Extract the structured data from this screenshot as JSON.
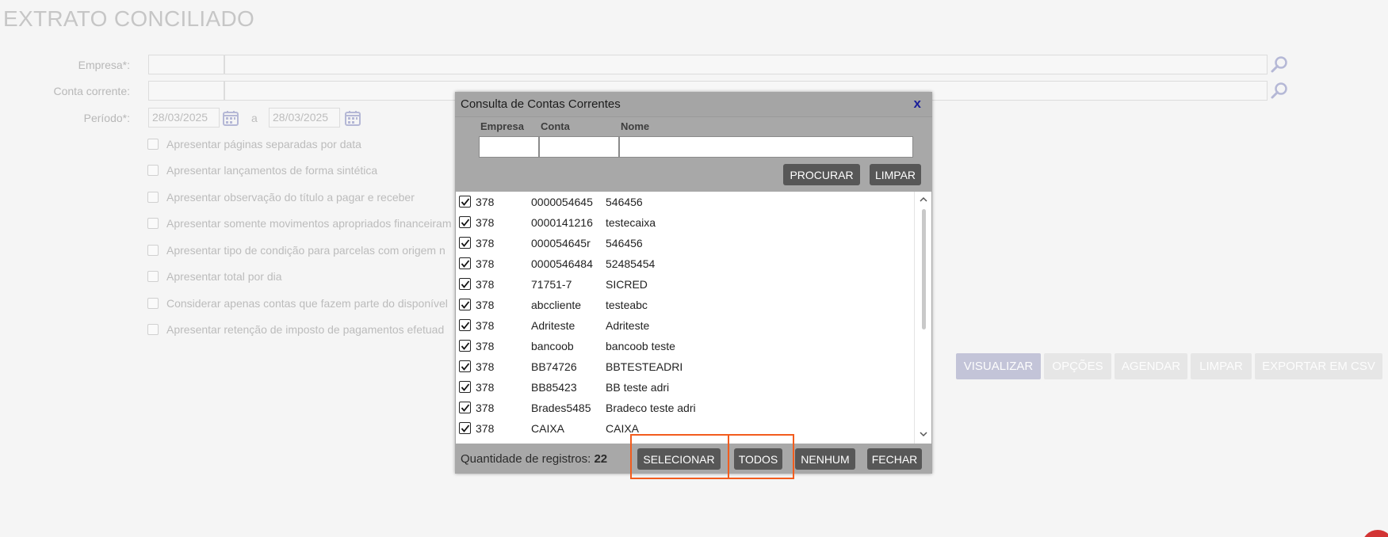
{
  "page": {
    "title": "EXTRATO CONCILIADO"
  },
  "form": {
    "empresa_label": "Empresa*:",
    "conta_label": "Conta corrente:",
    "periodo_label": "Período*:",
    "date_from": "28/03/2025",
    "date_sep": "a",
    "date_to": "28/03/2025"
  },
  "options": [
    "Apresentar páginas separadas por data",
    "Apresentar lançamentos de forma sintética",
    "Apresentar observação do título a pagar e receber",
    "Apresentar somente movimentos apropriados financeiram",
    "Apresentar tipo de condição para parcelas com origem n",
    "Apresentar total por dia",
    "Considerar apenas contas que fazem parte do disponível",
    "Apresentar retenção de imposto de pagamentos efetuad"
  ],
  "actions": {
    "visualizar": "VISUALIZAR",
    "opcoes": "OPÇÕES",
    "agendar": "AGENDAR",
    "limpar": "LIMPAR",
    "exportar": "EXPORTAR EM CSV"
  },
  "modal": {
    "title": "Consulta de Contas Correntes",
    "close": "x",
    "col_empresa": "Empresa",
    "col_conta": "Conta",
    "col_nome": "Nome",
    "procurar": "PROCURAR",
    "limpar": "LIMPAR",
    "rows": [
      {
        "empresa": "378",
        "conta": "0000054645",
        "nome": "546456"
      },
      {
        "empresa": "378",
        "conta": "0000141216",
        "nome": "testecaixa"
      },
      {
        "empresa": "378",
        "conta": "000054645r",
        "nome": "546456"
      },
      {
        "empresa": "378",
        "conta": "0000546484",
        "nome": "52485454"
      },
      {
        "empresa": "378",
        "conta": "71751-7",
        "nome": "SICRED"
      },
      {
        "empresa": "378",
        "conta": "abccliente",
        "nome": "testeabc"
      },
      {
        "empresa": "378",
        "conta": "Adriteste",
        "nome": "Adriteste"
      },
      {
        "empresa": "378",
        "conta": "bancoob",
        "nome": "bancoob teste"
      },
      {
        "empresa": "378",
        "conta": "BB74726",
        "nome": "BBTESTEADRI"
      },
      {
        "empresa": "378",
        "conta": "BB85423",
        "nome": "BB teste adri"
      },
      {
        "empresa": "378",
        "conta": "Brades5485",
        "nome": "Bradeco teste adri"
      },
      {
        "empresa": "378",
        "conta": "CAIXA",
        "nome": "CAIXA"
      }
    ],
    "count_label": "Quantidade de registros:",
    "count_value": "22",
    "selecionar": "SELECIONAR",
    "todos": "TODOS",
    "nenhum": "NENHUM",
    "fechar": "FECHAR"
  },
  "colors": {
    "highlight": "#f25c1d",
    "close_x": "#1a1f99",
    "primary_action": "#c3c4d8"
  }
}
